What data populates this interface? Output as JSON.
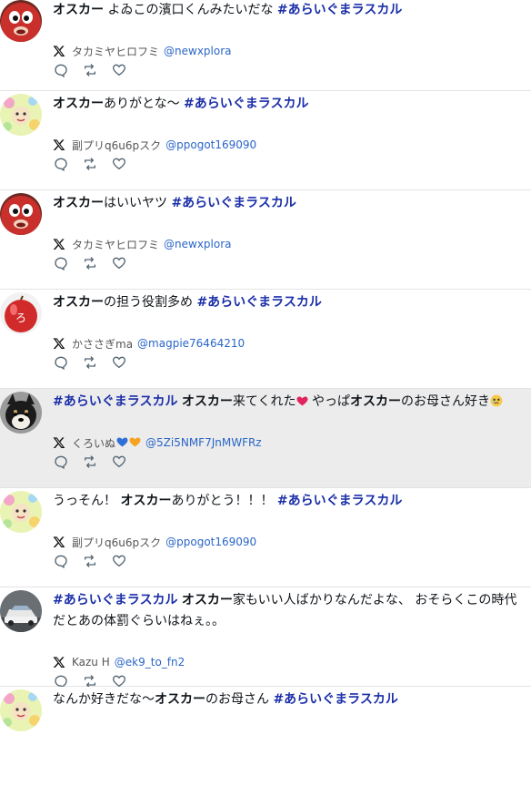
{
  "posts": [
    {
      "avatar": "red-mascot",
      "segments": [
        {
          "t": "オスカー",
          "s": "bold"
        },
        {
          "t": " よゐこの濱口くんみたいだな ",
          "s": "normal"
        },
        {
          "t": "#あらいぐまラスカル",
          "s": "tag"
        }
      ],
      "author": "タカミヤヒロフミ",
      "handle": "@newxplora",
      "highlight": false
    },
    {
      "avatar": "flower-bear",
      "segments": [
        {
          "t": "オスカー",
          "s": "bold"
        },
        {
          "t": "ありがとな〜 ",
          "s": "normal"
        },
        {
          "t": "#あらいぐまラスカル",
          "s": "tag"
        }
      ],
      "author": "副プリq6u6pスク",
      "handle": "@ppogot169090",
      "highlight": false
    },
    {
      "avatar": "red-mascot",
      "segments": [
        {
          "t": "オスカー",
          "s": "bold"
        },
        {
          "t": "はいいヤツ ",
          "s": "normal"
        },
        {
          "t": "#あらいぐまラスカル",
          "s": "tag"
        }
      ],
      "author": "タカミヤヒロフミ",
      "handle": "@newxplora",
      "highlight": false
    },
    {
      "avatar": "red-apple",
      "segments": [
        {
          "t": "オスカー",
          "s": "bold"
        },
        {
          "t": "の担う役割多め ",
          "s": "normal"
        },
        {
          "t": "#あらいぐまラスカル",
          "s": "tag"
        }
      ],
      "author": "かささぎma",
      "handle": "@magpie76464210",
      "highlight": false
    },
    {
      "avatar": "shiba-dog",
      "segments": [
        {
          "t": "#あらいぐまラスカル",
          "s": "tag"
        },
        {
          "t": " ",
          "s": "normal"
        },
        {
          "t": "オスカー",
          "s": "bold"
        },
        {
          "t": "来てくれた",
          "s": "normal"
        },
        {
          "t": "❣️",
          "s": "emoji-heart"
        },
        {
          "t": " やっぱ",
          "s": "normal"
        },
        {
          "t": "オスカー",
          "s": "bold"
        },
        {
          "t": "のお母さん好き",
          "s": "normal"
        },
        {
          "t": "🥹",
          "s": "emoji-face"
        }
      ],
      "author": "くろいぬ",
      "author_emojis": [
        "blue-heart",
        "orange-heart"
      ],
      "handle": "@5Zi5NMF7JnMWFRz",
      "highlight": true
    },
    {
      "avatar": "flower-bear",
      "segments": [
        {
          "t": "うっそん！ ",
          "s": "normal"
        },
        {
          "t": "オスカー",
          "s": "bold"
        },
        {
          "t": "ありがとう！！！ ",
          "s": "normal"
        },
        {
          "t": "#あらいぐまラスカル",
          "s": "tag"
        }
      ],
      "author": "副プリq6u6pスク",
      "handle": "@ppogot169090",
      "highlight": false
    },
    {
      "avatar": "car",
      "segments": [
        {
          "t": "#あらいぐまラスカル",
          "s": "tag"
        },
        {
          "t": " ",
          "s": "normal"
        },
        {
          "t": "オスカー",
          "s": "bold"
        },
        {
          "t": "家もいい人ばかりなんだよな、 おそらくこの時代だとあの体罰ぐらいはねぇ。。",
          "s": "normal"
        }
      ],
      "author": "Kazu H",
      "handle": "@ek9_to_fn2",
      "highlight": false
    },
    {
      "avatar": "flower-bear",
      "segments": [
        {
          "t": "なんか好きだな〜",
          "s": "normal"
        },
        {
          "t": "オスカー",
          "s": "bold"
        },
        {
          "t": "のお母さん ",
          "s": "normal"
        },
        {
          "t": "#あらいぐまラスカル",
          "s": "tag"
        }
      ],
      "author": "",
      "handle": "",
      "highlight": false
    }
  ],
  "icons": {
    "platform": "x-logo-icon",
    "reply": "reply-icon",
    "repost": "repost-icon",
    "like": "like-icon"
  },
  "colors": {
    "hashtag": "#1b2fa8",
    "handle": "#2a66c8",
    "highlight_bg": "#ececec",
    "divider": "#e3e3e3"
  }
}
